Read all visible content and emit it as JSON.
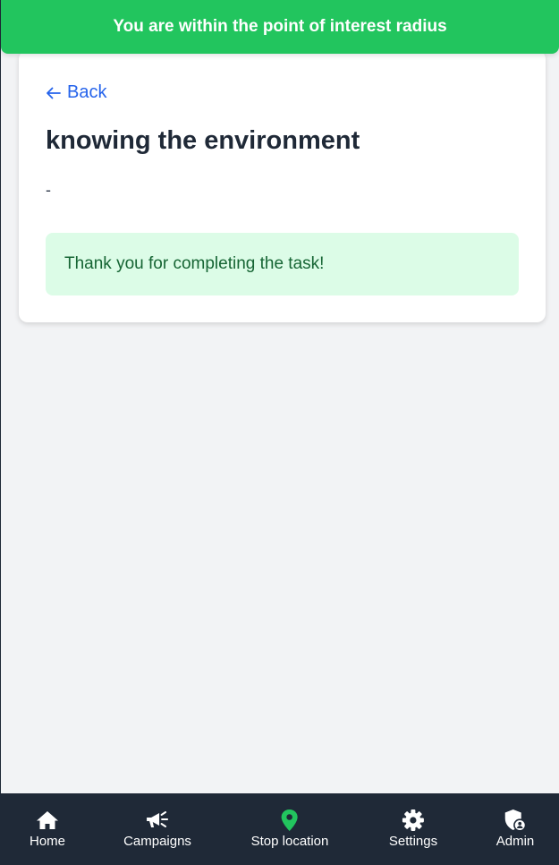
{
  "banner": {
    "text": "You are within the point of interest radius",
    "color": "#22c55e"
  },
  "task": {
    "back_label": "Back",
    "title": "knowing the environment",
    "description": "-",
    "success_message": "Thank you for completing the task!"
  },
  "nav": {
    "items": [
      {
        "label": "Home",
        "icon": "home-icon"
      },
      {
        "label": "Campaigns",
        "icon": "megaphone-icon"
      },
      {
        "label": "Stop location",
        "icon": "map-pin-icon",
        "active_color": "#22c55e"
      },
      {
        "label": "Settings",
        "icon": "gear-icon"
      },
      {
        "label": "Admin",
        "icon": "shield-user-icon"
      }
    ]
  },
  "colors": {
    "accent": "#22c55e",
    "link": "#2563eb",
    "nav_background": "#1f2937",
    "success_background": "#dcfce7",
    "success_text": "#166534"
  }
}
